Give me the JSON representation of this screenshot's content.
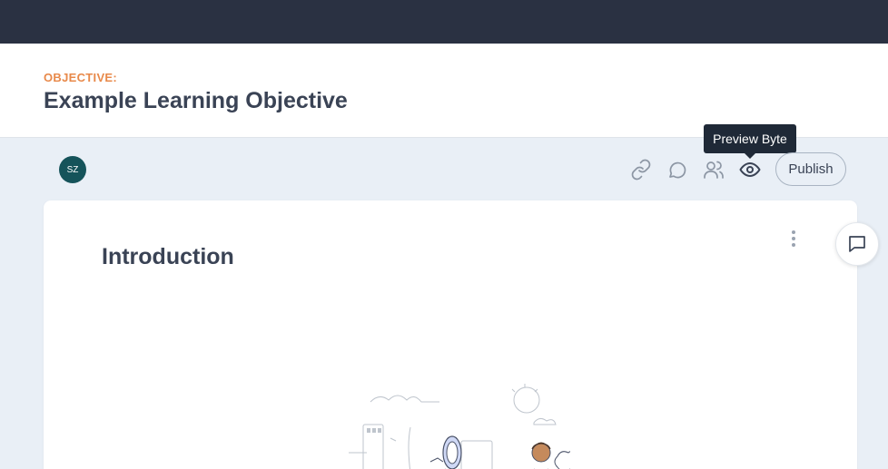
{
  "header": {
    "label": "OBJECTIVE:",
    "title": "Example Learning Objective"
  },
  "toolbar": {
    "avatar_initials": "SZ",
    "icons": [
      "link-icon",
      "comment-icon",
      "users-icon",
      "eye-icon"
    ],
    "tooltip": "Preview Byte",
    "publish_label": "Publish"
  },
  "card": {
    "title": "Introduction"
  },
  "colors": {
    "topbar": "#2a3142",
    "accent": "#e8894a",
    "avatar": "#15535a",
    "text": "#3a4355"
  }
}
